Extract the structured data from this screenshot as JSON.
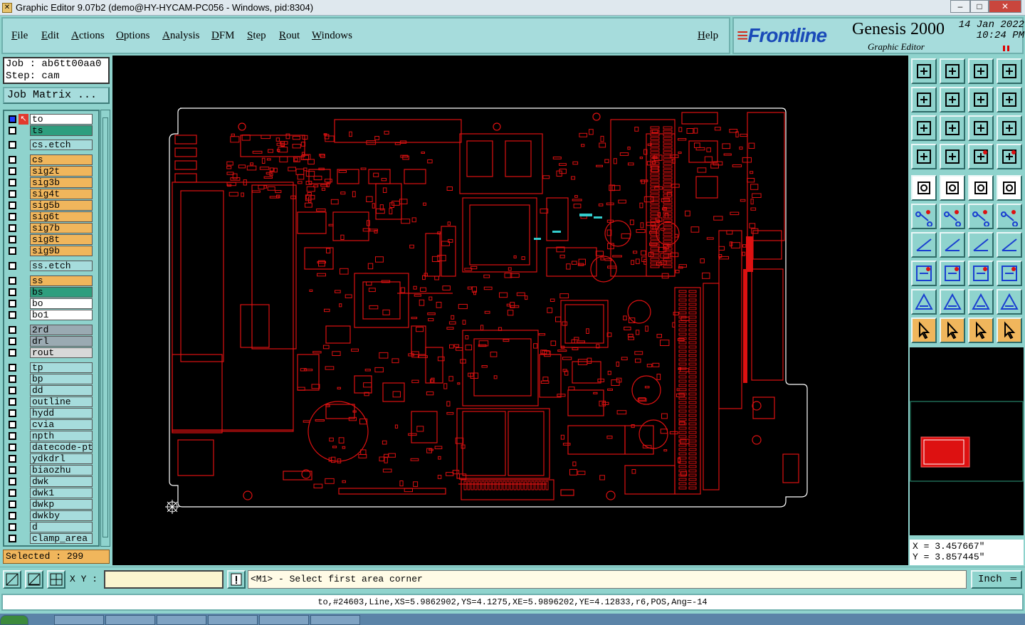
{
  "window": {
    "title": "Graphic Editor 9.07b2 (demo@HY-HYCAM-PC056 - Windows, pid:8304)",
    "controls": [
      "‒",
      "□",
      "✕"
    ]
  },
  "menu": {
    "items": [
      "File",
      "Edit",
      "Actions",
      "Options",
      "Analysis",
      "DFM",
      "Step",
      "Rout",
      "Windows"
    ],
    "help": "Help"
  },
  "brand": {
    "logo": "Frontline",
    "product": "Genesis 2000",
    "subtitle": "Graphic Editor",
    "date": "14 Jan 2022",
    "time": "10:24 PM"
  },
  "job": {
    "job_label": "Job : ab6tt00aa0",
    "step_label": "Step: cam",
    "matrix_button": "Job Matrix ..."
  },
  "layers": [
    {
      "name": "to",
      "color": "#ffffff"
    },
    {
      "name": "ts",
      "color": "#2e9e7e"
    },
    {
      "name": "cs.etch",
      "color": "#a6dcdc"
    },
    {
      "name": "cs",
      "color": "#f0b65c"
    },
    {
      "name": "sig2t",
      "color": "#f0b65c"
    },
    {
      "name": "sig3b",
      "color": "#f0b65c"
    },
    {
      "name": "sig4t",
      "color": "#f0b65c"
    },
    {
      "name": "sig5b",
      "color": "#f0b65c"
    },
    {
      "name": "sig6t",
      "color": "#f0b65c"
    },
    {
      "name": "sig7b",
      "color": "#f0b65c"
    },
    {
      "name": "sig8t",
      "color": "#f0b65c"
    },
    {
      "name": "sig9b",
      "color": "#f0b65c"
    },
    {
      "name": "ss.etch",
      "color": "#a6dcdc"
    },
    {
      "name": "ss",
      "color": "#f0b65c"
    },
    {
      "name": "bs",
      "color": "#2e9e7e"
    },
    {
      "name": "bo",
      "color": "#ffffff"
    },
    {
      "name": "bo1",
      "color": "#ffffff"
    },
    {
      "name": "2rd",
      "color": "#9aaab2"
    },
    {
      "name": "drl",
      "color": "#9aaab2"
    },
    {
      "name": "rout",
      "color": "#d8d8d8"
    },
    {
      "name": "tp",
      "color": "#a6dcdc"
    },
    {
      "name": "bp",
      "color": "#a6dcdc"
    },
    {
      "name": "dd",
      "color": "#a6dcdc"
    },
    {
      "name": "outline",
      "color": "#a6dcdc"
    },
    {
      "name": "hydd",
      "color": "#a6dcdc"
    },
    {
      "name": "cvia",
      "color": "#a6dcdc"
    },
    {
      "name": "npth",
      "color": "#a6dcdc"
    },
    {
      "name": "datecode-ptc",
      "color": "#a6dcdc"
    },
    {
      "name": "ydkdrl",
      "color": "#a6dcdc"
    },
    {
      "name": "biaozhu",
      "color": "#a6dcdc"
    },
    {
      "name": "dwk",
      "color": "#a6dcdc"
    },
    {
      "name": "dwk1",
      "color": "#a6dcdc"
    },
    {
      "name": "dwkp",
      "color": "#a6dcdc"
    },
    {
      "name": "dwkby",
      "color": "#a6dcdc"
    },
    {
      "name": "d",
      "color": "#a6dcdc"
    },
    {
      "name": "clamp_area",
      "color": "#a6dcdc"
    }
  ],
  "selected": "Selected : 299",
  "coords": {
    "x": "X = 3.457667\"",
    "y": "Y = 3.857445\""
  },
  "bottom": {
    "xy_label": "X Y :",
    "xy_value": "",
    "prompt": "<M1> - Select first area corner",
    "unit": "Inch"
  },
  "status": "to,#24603,Line,XS=5.9862902,YS=4.1275,XE=5.9896202,YE=4.12833,r6,POS,Ang=-14",
  "colors": {
    "pcb": "#dd1111",
    "highlight": "#33cccc",
    "panel": "#8fd3cd",
    "accent_orange": "#f0b65c"
  },
  "tool_icons": [
    "view-home-icon",
    "view-save-icon",
    "view-restore-icon",
    "window-split-icon",
    "pan-left-icon",
    "pan-right-icon",
    "zoom-fit-icon",
    "zoom-step-icon",
    "zoom-all-icon",
    "zoom-center-icon",
    "zoom-1to2-icon",
    "help-icon",
    "snap-settings-icon",
    "measure-icon",
    "layer-features-icon",
    "layer-features-alt-icon",
    "feature-info-icon",
    "layer-compare-icon",
    "ruler-icon",
    "pad-icon",
    "connect-nodes-icon",
    "delete-node-icon",
    "move-node-icon",
    "add-node-icon",
    "line-angle-icon",
    "line-draw-icon",
    "arc-icon",
    "mirror-icon",
    "select-point-icon",
    "break-line-icon",
    "select-region-icon",
    "flip-icon",
    "triangle-outline-icon",
    "triangle-add-icon",
    "triangle-move-icon",
    "triangle-cut-icon",
    "pointer-icon",
    "pointer-select-icon",
    "pointer-box-icon",
    "pointer-net-icon"
  ]
}
